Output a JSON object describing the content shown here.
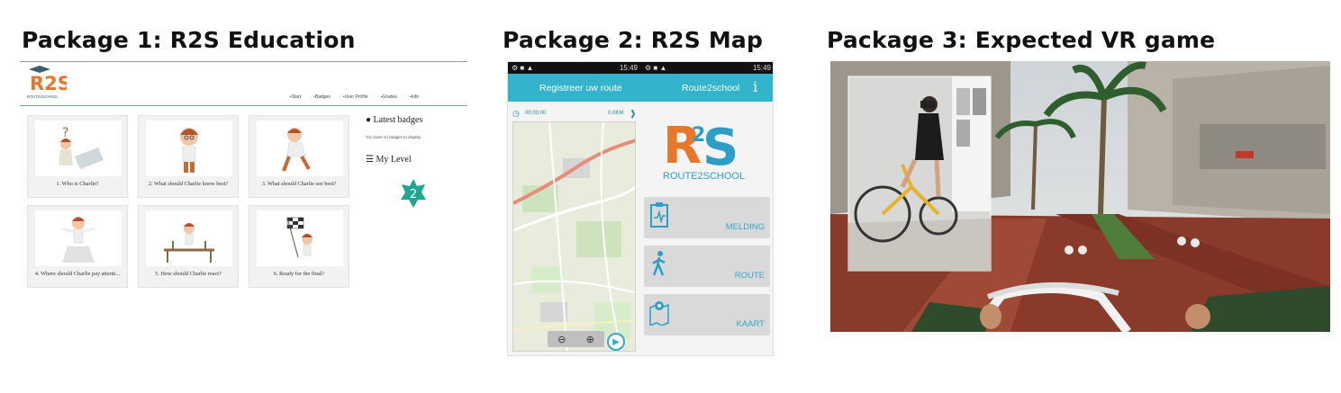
{
  "titles": {
    "package1": "Package 1: R2S Education",
    "package2": "Package 2: R2S Map",
    "package3": "Package 3: Expected VR game"
  },
  "education": {
    "logo_text": "R2S",
    "logo_sub": "ROUTE 2 SCHOOL",
    "nav": [
      "Start",
      "Badges",
      "User Profile",
      "Grades",
      "Info"
    ],
    "cards": [
      "1. Who is Charlie?",
      "2. What should Charlie know best?",
      "3. What should Charlie see best?",
      "4. Where should Charlie pay attenti...",
      "5. How should Charlie react?",
      "6. Ready for the final?"
    ],
    "latest_badges": "Latest badges",
    "no_badges": "You have no badges to display",
    "my_level": "My Level",
    "level_value": "2"
  },
  "map_app": {
    "time_left": "15:49",
    "time_right": "15:49",
    "header_left": "Registreer uw route",
    "header_right": "Route2school",
    "info_icon": "i",
    "timer": "00:00:00",
    "distance": "0.0KM",
    "logo_text": "R2S",
    "logo_sub": "ROUTE2SCHOOL",
    "buttons": [
      "MELDING",
      "ROUTE",
      "KAART"
    ],
    "zoom_out": "⊖",
    "zoom_in": "⊕",
    "play_icon": "▶"
  },
  "vr_game": {
    "colors": {
      "path_red": "#8a3a2a",
      "sky": "#d8dce0",
      "building": "#bdb6aa"
    }
  }
}
